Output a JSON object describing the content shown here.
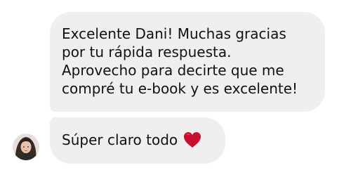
{
  "thread": {
    "messages": [
      {
        "lines": [
          "Excelente Dani! Muchas gracias",
          "por tu rápida respuesta.",
          "Aprovecho para decirte que me",
          "compré tu e-book y es excelente!"
        ]
      },
      {
        "text": "Súper claro todo",
        "emoji": "heart-icon"
      }
    ]
  },
  "colors": {
    "bubble": "#efefef",
    "text": "#111111",
    "heart": "#c8102e"
  }
}
